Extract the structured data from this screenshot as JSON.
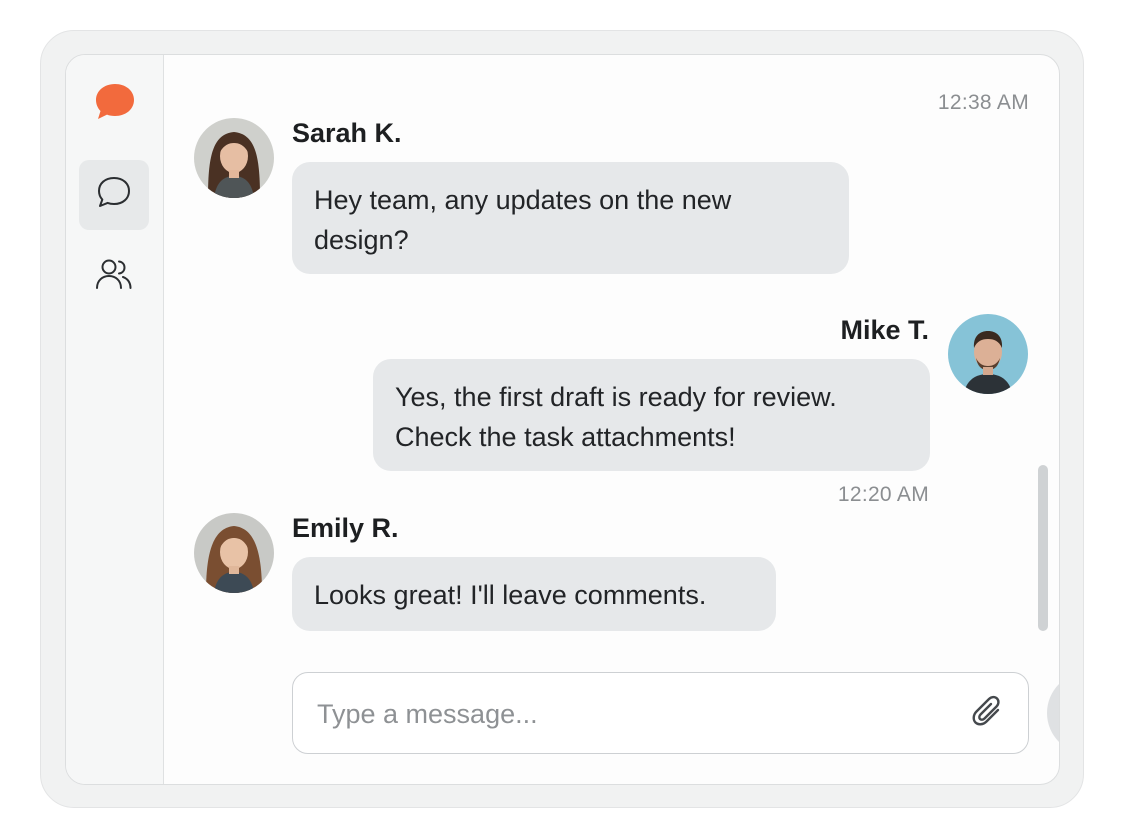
{
  "sidebar": {
    "logo_icon": "chat-bubble-logo",
    "logo_color": "#f26a3d",
    "nav": [
      {
        "icon": "chat-icon",
        "active": true
      },
      {
        "icon": "users-icon",
        "active": false
      }
    ]
  },
  "messages": [
    {
      "timestamp": "12:38 AM",
      "sender": "Sarah K.",
      "text": "Hey team, any updates on the new design?",
      "align": "left"
    },
    {
      "sender": "Mike T.",
      "text": "Yes, the first draft is ready for review. Check the task attachments!",
      "timestamp": "12:20 AM",
      "align": "right"
    },
    {
      "sender": "Emily R.",
      "text": "Looks great! I'll leave comments.",
      "align": "left"
    }
  ],
  "composer": {
    "placeholder": "Type a message...",
    "attach_icon": "paperclip-icon",
    "send_icon": "send-icon"
  },
  "colors": {
    "bubble": "#e6e8ea",
    "accent": "#f26a3d"
  }
}
